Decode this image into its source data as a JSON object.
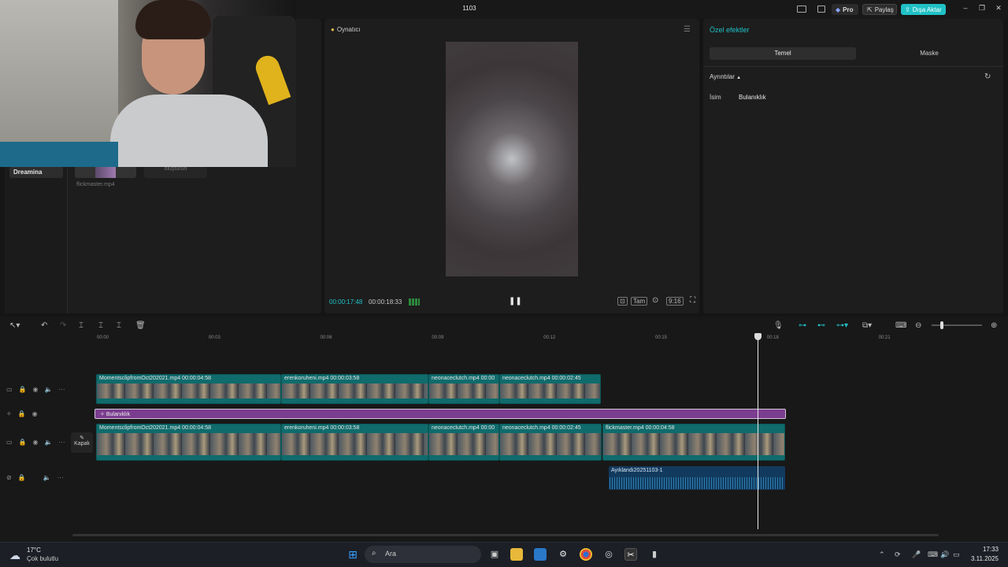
{
  "app": {
    "project_title": "1103",
    "pro_label": "Pro",
    "share_label": "Paylaş",
    "export_label": "Dışa Aktar"
  },
  "media": {
    "sidebar_item": "Dreamina",
    "thumb2_text": "oluşturun",
    "file_name": "flickmaster.mp4"
  },
  "player": {
    "label": "Oynatıcı",
    "current_time": "00:00:17:48",
    "total_time": "00:00:18:33",
    "full_label": "Tam",
    "ratio_label": "9:16"
  },
  "effects": {
    "title": "Özel efektler",
    "tab_basic": "Temel",
    "tab_mask": "Maske",
    "details_label": "Ayrıntılar",
    "name_key": "İsim",
    "name_value": "Bulanıklık"
  },
  "timeline": {
    "ticks": [
      "00:00",
      "00:03",
      "00:06",
      "00:09",
      "00:12",
      "00:15",
      "00:18",
      "00:21"
    ],
    "fx_clip_label": "Bulanıklık",
    "cover_label": "Kapak",
    "overlay_clips": [
      {
        "label": "MomentsclipfromOct202021.mp4  00:00:04:58"
      },
      {
        "label": "erenkoruheni.mp4  00:00:03:58"
      },
      {
        "label": "neonaceclutch.mp4  00:00"
      },
      {
        "label": "neonaceclutch.mp4  00:00:02:45"
      }
    ],
    "main_clips": [
      {
        "label": "MomentsclipfromOct202021.mp4  00:00:04:58"
      },
      {
        "label": "erenkoruheni.mp4  00:00:03:58"
      },
      {
        "label": "neonaceclutch.mp4  00:00"
      },
      {
        "label": "neonaceclutch.mp4  00:00:02:45"
      },
      {
        "label": "flickmaster.mp4  00:00:04:58"
      }
    ],
    "audio_clip_label": "Ayıklandı20251103-1"
  },
  "taskbar": {
    "temperature": "17°C",
    "weather": "Çok bulutlu",
    "search_placeholder": "Ara",
    "time": "17:33",
    "date": "3.11.2025"
  }
}
